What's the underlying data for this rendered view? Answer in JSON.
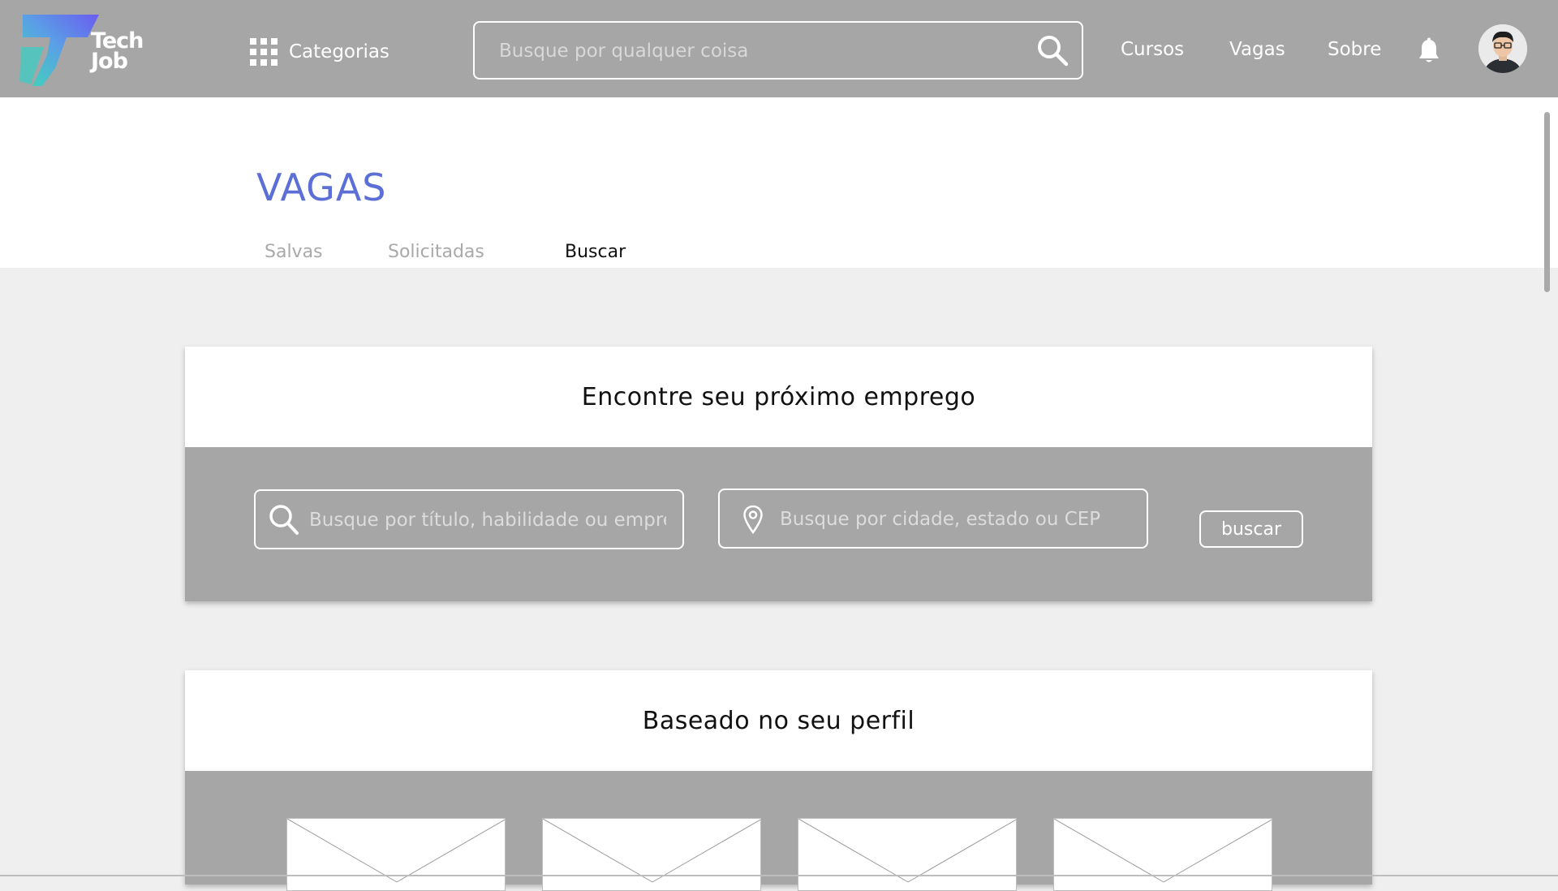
{
  "brand": {
    "line1": "Tech",
    "line2": "Job"
  },
  "header": {
    "categories_label": "Categorias",
    "search_placeholder": "Busque por qualquer coisa",
    "nav": [
      "Cursos",
      "Vagas",
      "Sobre"
    ]
  },
  "page": {
    "title": "VAGAS",
    "tabs": [
      {
        "label": "Salvas",
        "active": false
      },
      {
        "label": "Solicitadas",
        "active": false
      },
      {
        "label": "Buscar",
        "active": true
      }
    ]
  },
  "search_card": {
    "title": "Encontre seu próximo emprego",
    "job_placeholder": "Busque por título, habilidade ou empresa",
    "location_placeholder": "Busque por cidade, estado ou CEP",
    "button_label": "buscar"
  },
  "profile_card": {
    "title": "Baseado no seu perfil",
    "thumbnail_count": 4
  },
  "colors": {
    "header_bg": "#a6a6a6",
    "title_accent": "#5b6fd6",
    "page_bg": "#efefef"
  },
  "icons": {
    "categories": "grid-icon",
    "search": "search-icon",
    "notifications": "bell-icon",
    "location": "location-pin-icon"
  }
}
